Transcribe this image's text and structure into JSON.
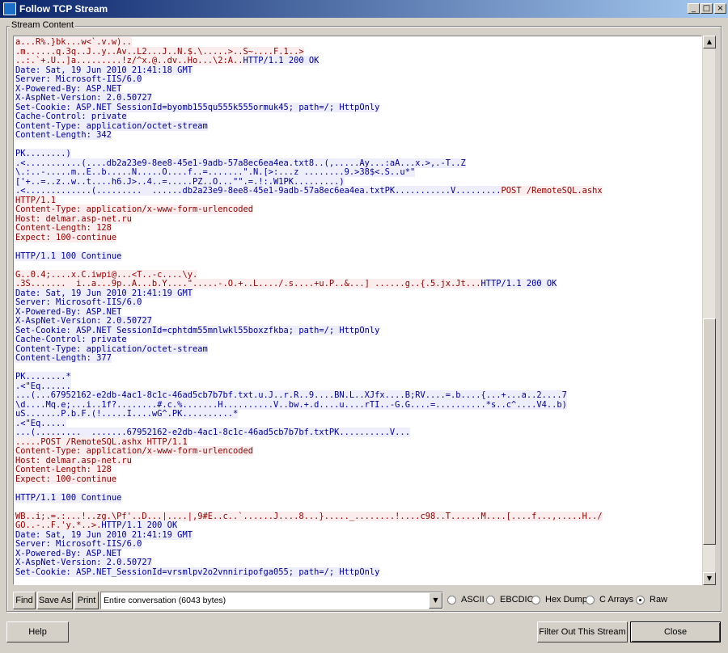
{
  "window": {
    "title": "Follow TCP Stream",
    "min_glyph": "_",
    "max_glyph": "□",
    "close_glyph": "×"
  },
  "group_label": "Stream Content",
  "stream": [
    {
      "d": "c",
      "t": "a...R%.}bk...w<`.v.w).."
    },
    {
      "d": "c",
      "t": ".m......q.3q..J..y..Av..L2...J..N.$.\\.....>..S~....F.1..>"
    },
    {
      "d": "c",
      "t": "..:.`+.U..]a.........!z/^x.@..dv..Ho...\\2:A..",
      "s": "HTTP/1.1 200 OK"
    },
    {
      "d": "s",
      "t": "Date: Sat, 19 Jun 2010 21:41:18 GMT"
    },
    {
      "d": "s",
      "t": "Server: Microsoft-IIS/6.0"
    },
    {
      "d": "s",
      "t": "X-Powered-By: ASP.NET"
    },
    {
      "d": "s",
      "t": "X-AspNet-Version: 2.0.50727"
    },
    {
      "d": "s",
      "t": "Set-Cookie: ASP.NET_SessionId=byomb155qu555k555ormuk45; path=/; HttpOnly"
    },
    {
      "d": "s",
      "t": "Cache-Control: private"
    },
    {
      "d": "s",
      "t": "Content-Type: application/octet-stream"
    },
    {
      "d": "s",
      "t": "Content-Length: 342"
    },
    {
      "d": "s",
      "t": ""
    },
    {
      "d": "s",
      "t": "PK........)"
    },
    {
      "d": "s",
      "t": ".<...........(....db2a23e9-8ee8-45e1-9adb-57a8ec6ea4ea.txt8..(,.....Ay...:aA...x.>,.-T..Z"
    },
    {
      "d": "s",
      "t": "\\.:..-.....m..E..b.....N.....O....f..=.......\".N.[>:...z ........9.>38$<.S..u*\""
    },
    {
      "d": "s",
      "t": "['+..=..z..w..t....h6.J>..4..=.....PZ..O...\"\".=.!:.W1PK.........)"
    },
    {
      "d": "s",
      "t": ".<.............(.........  ......db2a23e9-8ee8-45e1-9adb-57a8ec6ea4ea.txtPK...........V.........",
      "c": "POST /RemoteSQL.ashx"
    },
    {
      "d": "c",
      "t": "HTTP/1.1"
    },
    {
      "d": "c",
      "t": "Content-Type: application/x-www-form-urlencoded"
    },
    {
      "d": "c",
      "t": "Host: delmar.asp-net.ru"
    },
    {
      "d": "c",
      "t": "Content-Length: 128"
    },
    {
      "d": "c",
      "t": "Expect: 100-continue"
    },
    {
      "d": "c",
      "t": ""
    },
    {
      "d": "s",
      "t": "HTTP/1.1 100 Continue"
    },
    {
      "d": "s",
      "t": ""
    },
    {
      "d": "c",
      "t": "G..0.4;....x.C.iwpi@...<T..-c....\\y."
    },
    {
      "d": "c",
      "t": ".3S.......  i..a...9p..A...b.Y....\".....-.O.+..L..../.s....+u.P..&...] ......g..{.5.jx.Jt...",
      "s": "HTTP/1.1 200 OK"
    },
    {
      "d": "s",
      "t": "Date: Sat, 19 Jun 2010 21:41:19 GMT"
    },
    {
      "d": "s",
      "t": "Server: Microsoft-IIS/6.0"
    },
    {
      "d": "s",
      "t": "X-Powered-By: ASP.NET"
    },
    {
      "d": "s",
      "t": "X-AspNet-Version: 2.0.50727"
    },
    {
      "d": "s",
      "t": "Set-Cookie: ASP.NET_SessionId=cphtdm55mnlwkl55boxzfkba; path=/; HttpOnly"
    },
    {
      "d": "s",
      "t": "Cache-Control: private"
    },
    {
      "d": "s",
      "t": "Content-Type: application/octet-stream"
    },
    {
      "d": "s",
      "t": "Content-Length: 377"
    },
    {
      "d": "s",
      "t": ""
    },
    {
      "d": "s",
      "t": "PK........*"
    },
    {
      "d": "s",
      "t": ".<\"Eq......"
    },
    {
      "d": "s",
      "t": "...(...67952162-e2db-4ac1-8c1c-46ad5cb7b7bf.txt.u.J..r.R..9....BN.L..XJfx....B;RV....=.b....{...+...a..2....7"
    },
    {
      "d": "s",
      "t": "\\d....Mq.e;...i..1f?........#.c.%.......H..........V..bw.+.d....u....rTI..-G.G....=..........*s..c^....V4..b)"
    },
    {
      "d": "s",
      "t": "uS.......P.b.F.(!.....I....wG^.PK..........*"
    },
    {
      "d": "s",
      "t": ".<\"Eq....."
    },
    {
      "d": "s",
      "t": "...(.........  .......67952162-e2db-4ac1-8c1c-46ad5cb7b7bf.txtPK..........V..."
    },
    {
      "d": "c",
      "t": ".....POST /RemoteSQL.ashx HTTP/1.1"
    },
    {
      "d": "c",
      "t": "Content-Type: application/x-www-form-urlencoded"
    },
    {
      "d": "c",
      "t": "Host: delmar.asp-net.ru"
    },
    {
      "d": "c",
      "t": "Content-Length: 128"
    },
    {
      "d": "c",
      "t": "Expect: 100-continue"
    },
    {
      "d": "c",
      "t": ""
    },
    {
      "d": "s",
      "t": "HTTP/1.1 100 Continue"
    },
    {
      "d": "s",
      "t": ""
    },
    {
      "d": "c",
      "t": "WB..i;.=.:...!..zg.\\Pf'..D...|....|,9#E..c..`......J....8...}....._........!....c98..T......M....[....f...,.....H../"
    },
    {
      "d": "c",
      "t": "GO..-..F.'y.*..>.",
      "s": "HTTP/1.1 200 OK"
    },
    {
      "d": "s",
      "t": "Date: Sat, 19 Jun 2010 21:41:19 GMT"
    },
    {
      "d": "s",
      "t": "Server: Microsoft-IIS/6.0"
    },
    {
      "d": "s",
      "t": "X-Powered-By: ASP.NET"
    },
    {
      "d": "s",
      "t": "X-AspNet-Version: 2.0.50727"
    },
    {
      "d": "s",
      "t": "Set-Cookie: ASP.NET_SessionId=vrsmlpv2o2vnniripofga055; path=/; HttpOnly"
    }
  ],
  "toolbar": {
    "find": "Find",
    "save_as": "Save As",
    "print": "Print",
    "conversation": "Entire conversation (6043 bytes)"
  },
  "formats": [
    {
      "label": "ASCII",
      "selected": false
    },
    {
      "label": "EBCDIC",
      "selected": false
    },
    {
      "label": "Hex Dump",
      "selected": false
    },
    {
      "label": "C Arrays",
      "selected": false
    },
    {
      "label": "Raw",
      "selected": true
    }
  ],
  "bottom": {
    "help": "Help",
    "filter_out": "Filter Out This Stream",
    "close": "Close"
  },
  "colors": {
    "client_text": "#8b0000",
    "client_bg": "#fbeded",
    "server_text": "#00008b",
    "server_bg": "#ededfb"
  }
}
